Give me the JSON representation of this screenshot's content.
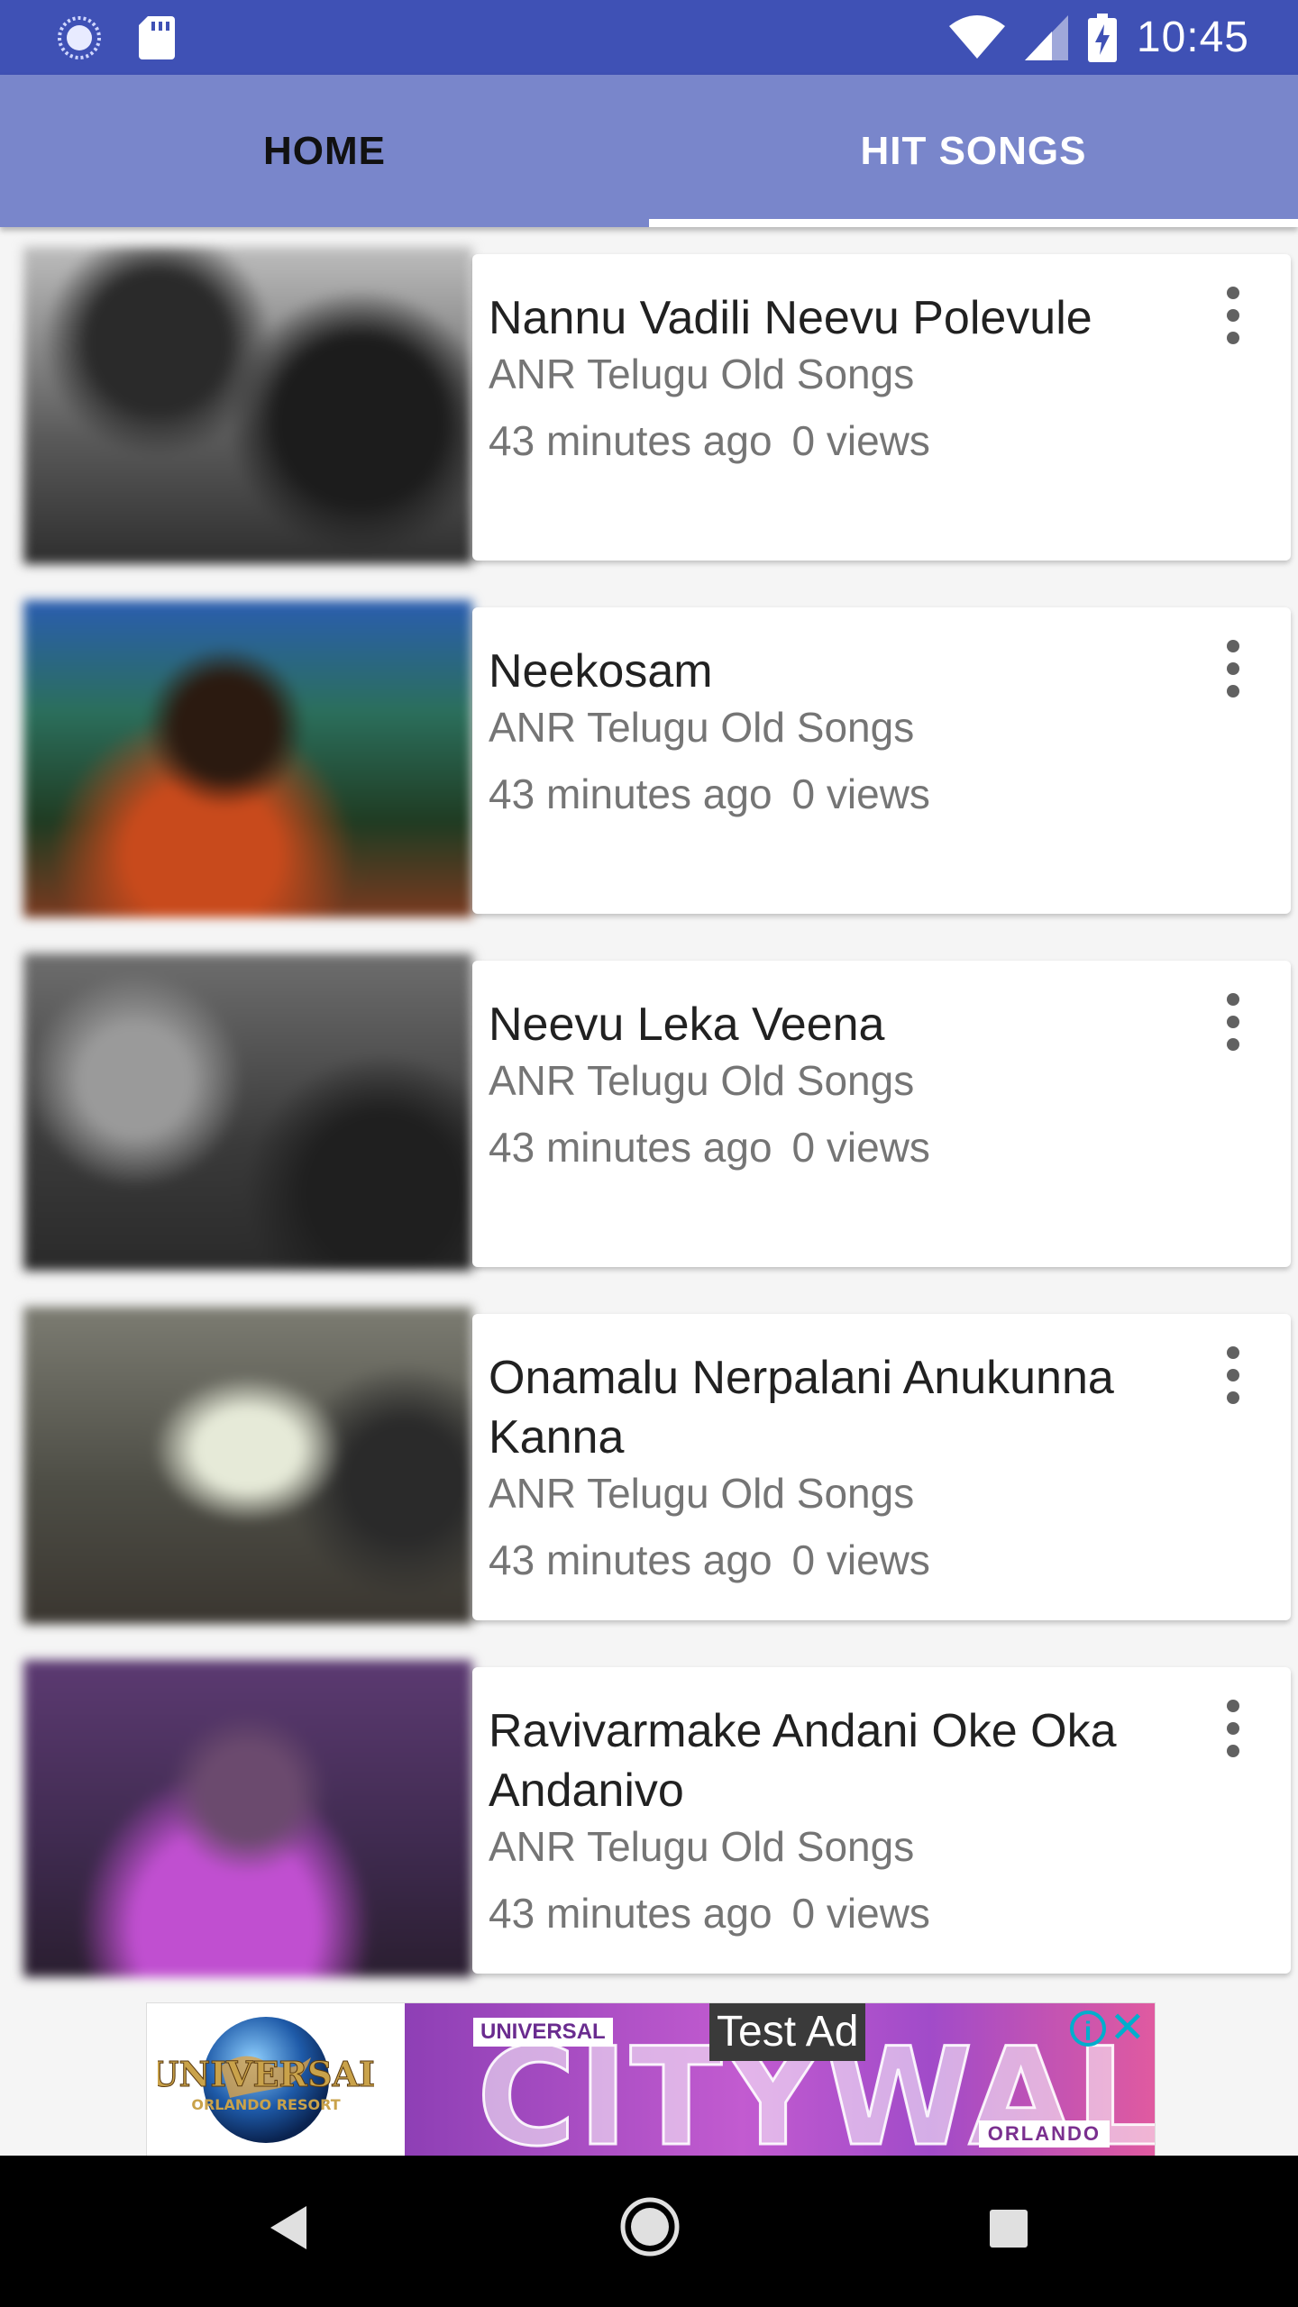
{
  "status_bar": {
    "time": "10:45"
  },
  "tabs": [
    {
      "label": "HOME",
      "selected": false
    },
    {
      "label": "HIT SONGS",
      "selected": true
    }
  ],
  "videos": [
    {
      "title": "Nannu Vadili Neevu Polevule",
      "channel": "ANR Telugu Old Songs",
      "time_ago": "43 minutes ago",
      "views": "0 views"
    },
    {
      "title": "Neekosam",
      "channel": "ANR Telugu Old Songs",
      "time_ago": "43 minutes ago",
      "views": "0 views"
    },
    {
      "title": "Neevu Leka Veena",
      "channel": "ANR Telugu Old Songs",
      "time_ago": "43 minutes ago",
      "views": "0 views"
    },
    {
      "title": "Onamalu Nerpalani Anukunna Kanna",
      "channel": "ANR Telugu Old Songs",
      "time_ago": "43 minutes ago",
      "views": "0 views"
    },
    {
      "title": "Ravivarmake Andani Oke Oka Andanivo",
      "channel": "ANR Telugu Old Songs",
      "time_ago": "43 minutes ago",
      "views": "0 views"
    }
  ],
  "ad": {
    "label": "Test Ad",
    "brand_logo": "UNIVERSAL ORLANDO RESORT",
    "banner_prefix": "UNIVERSAL",
    "banner_word": "CITYWALK",
    "banner_location": "ORLANDO",
    "info_icon": "info-icon",
    "close_icon": "close-icon"
  },
  "colors": {
    "status_bar": "#3f51b5",
    "tab_bar": "#7986cb",
    "card": "#ffffff",
    "title_text": "#212121",
    "meta_text": "#757575"
  }
}
